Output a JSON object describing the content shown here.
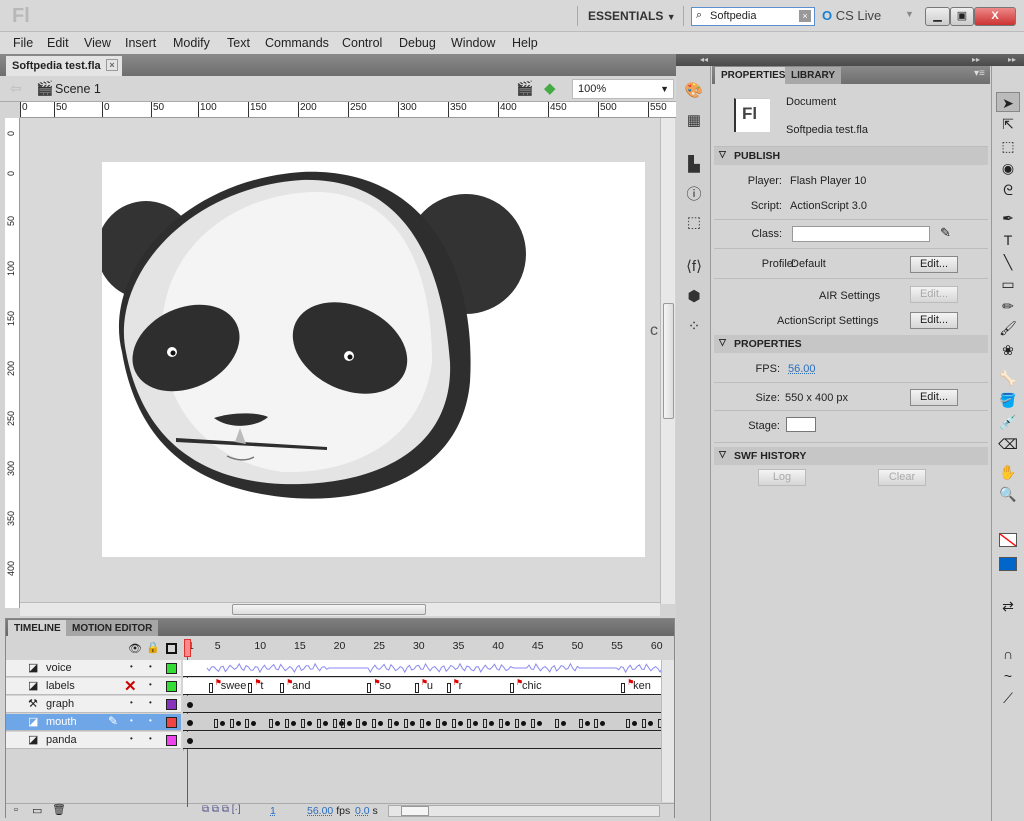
{
  "app": {
    "logo": "Fl",
    "workspace": "ESSENTIALS",
    "search_value": "Softpedia",
    "cs_live": "CS Live"
  },
  "menu": [
    "File",
    "Edit",
    "View",
    "Insert",
    "Modify",
    "Text",
    "Commands",
    "Control",
    "Debug",
    "Window",
    "Help"
  ],
  "document_tab": "Softpedia test.fla",
  "editbar": {
    "scene": "Scene 1",
    "zoom": "100%"
  },
  "ruler_h": [
    "0",
    "50",
    "0",
    "50",
    "100",
    "150",
    "200",
    "250",
    "300",
    "350",
    "400",
    "450",
    "500",
    "550"
  ],
  "ruler_v": [
    "0",
    "0",
    "50",
    "100",
    "150",
    "200",
    "250",
    "300",
    "350",
    "400"
  ],
  "timeline": {
    "tabs": [
      "TIMELINE",
      "MOTION EDITOR"
    ],
    "frame_numbers": [
      "1",
      "5",
      "10",
      "15",
      "20",
      "25",
      "30",
      "35",
      "40",
      "45",
      "50",
      "55",
      "60"
    ],
    "layers": [
      {
        "name": "voice",
        "color": "#33dd33"
      },
      {
        "name": "labels",
        "color": "#33dd33"
      },
      {
        "name": "graph",
        "color": "#8833bb"
      },
      {
        "name": "mouth",
        "color": "#ee4444",
        "selected": true
      },
      {
        "name": "panda",
        "color": "#ee44ee"
      }
    ],
    "frame_labels": [
      {
        "frame": 5,
        "text": "swee"
      },
      {
        "frame": 10,
        "text": "t"
      },
      {
        "frame": 14,
        "text": "and"
      },
      {
        "frame": 25,
        "text": "so"
      },
      {
        "frame": 31,
        "text": "u"
      },
      {
        "frame": 35,
        "text": "r"
      },
      {
        "frame": 43,
        "text": "chic"
      },
      {
        "frame": 57,
        "text": "ken"
      }
    ],
    "current_frame": "1",
    "fps": "56.00",
    "fps_unit": "fps",
    "time": "0.0",
    "time_unit": "s"
  },
  "properties": {
    "tabs": [
      "PROPERTIES",
      "LIBRARY"
    ],
    "doc_type": "Document",
    "doc_name": "Softpedia test.fla",
    "publish": {
      "title": "PUBLISH",
      "player_label": "Player:",
      "player": "Flash Player 10",
      "script_label": "Script:",
      "script": "ActionScript 3.0",
      "class_label": "Class:",
      "class_value": "",
      "profile_label": "Profile:",
      "profile": "Default",
      "edit": "Edit...",
      "air": "AIR Settings",
      "as_settings": "ActionScript Settings"
    },
    "props": {
      "title": "PROPERTIES",
      "fps_label": "FPS:",
      "fps": "56.00",
      "size_label": "Size:",
      "size": "550 x 400 px",
      "stage_label": "Stage:",
      "stage_color": "#ffffff"
    },
    "swf": {
      "title": "SWF HISTORY",
      "log": "Log",
      "clear": "Clear"
    }
  },
  "tools": [
    "selection",
    "subselection",
    "free-transform",
    "3d-rotation",
    "lasso",
    "pen",
    "text",
    "line",
    "rectangle",
    "pencil",
    "brush",
    "deco",
    "bone",
    "paint-bucket",
    "eyedropper",
    "eraser",
    "hand",
    "zoom",
    "stroke-color",
    "fill-color",
    "swap-colors",
    "snap",
    "smooth",
    "straighten"
  ],
  "colors": {
    "stroke": "#ff0000",
    "fill": "#0066cc",
    "selected_layer": "#6fa6e8"
  }
}
